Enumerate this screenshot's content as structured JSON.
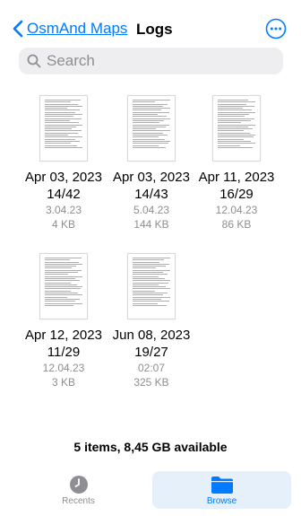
{
  "nav": {
    "back_label": "OsmAnd Maps",
    "title": "Logs"
  },
  "search": {
    "placeholder": "Search"
  },
  "files": [
    {
      "name_line1": "Apr 03, 2023",
      "name_line2": "14/42",
      "date": "3.04.23",
      "size": "4 KB"
    },
    {
      "name_line1": "Apr 03, 2023",
      "name_line2": "14/43",
      "date": "5.04.23",
      "size": "144 KB"
    },
    {
      "name_line1": "Apr 11, 2023",
      "name_line2": "16/29",
      "date": "12.04.23",
      "size": "86 KB"
    },
    {
      "name_line1": "Apr 12, 2023",
      "name_line2": "11/29",
      "date": "12.04.23",
      "size": "3 KB"
    },
    {
      "name_line1": "Jun 08, 2023",
      "name_line2": "19/27",
      "date": "02:07",
      "size": "325 KB"
    }
  ],
  "footer": {
    "status": "5 items, 8,45 GB available"
  },
  "tabbar": {
    "recents_label": "Recents",
    "browse_label": "Browse"
  },
  "colors": {
    "accent": "#007aff",
    "secondary_text": "#8e8e93",
    "search_bg": "#eeeef0",
    "selected_tab_bg": "#e6f0fb"
  }
}
